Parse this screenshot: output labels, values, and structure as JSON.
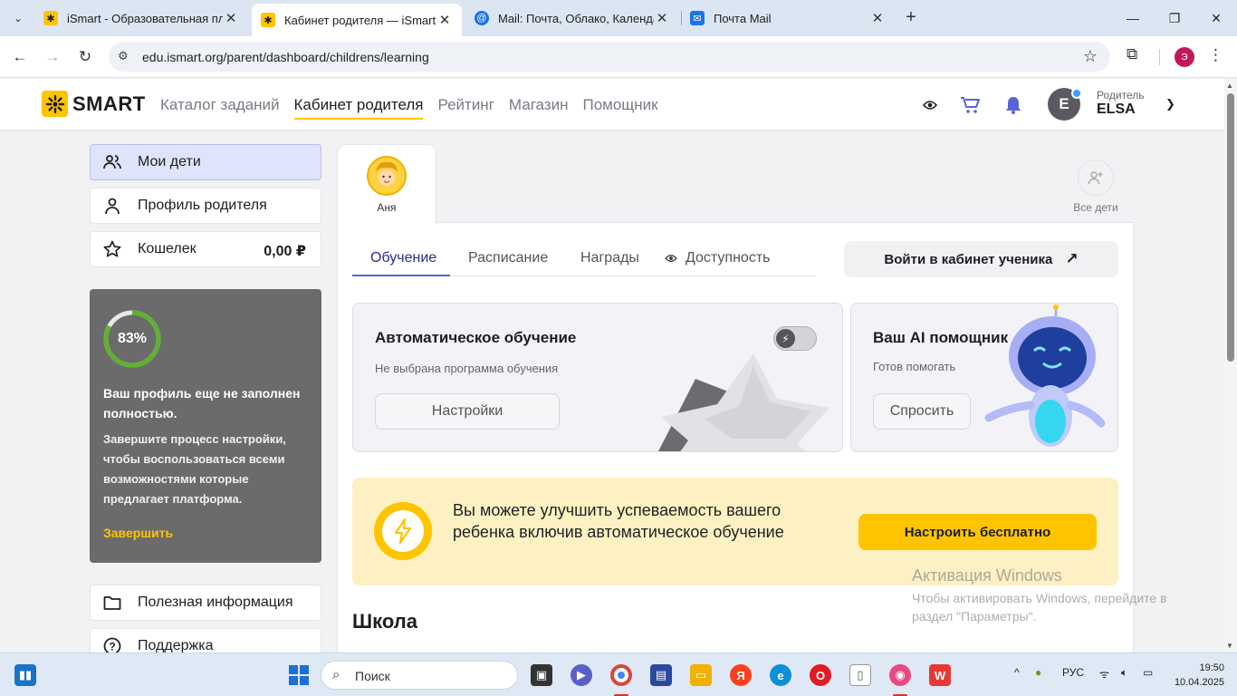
{
  "browser": {
    "tabs": [
      {
        "title": "iSmart - Образовательная пла",
        "active": false
      },
      {
        "title": "Кабинет родителя — iSmart",
        "active": true
      },
      {
        "title": "Mail: Почта, Облако, Календар",
        "active": false
      },
      {
        "title": "Почта Mail",
        "active": false
      }
    ],
    "url": "edu.ismart.org/parent/dashboard/childrens/learning",
    "profile_initial": "Э"
  },
  "header": {
    "logo": "SMART",
    "nav": [
      "Каталог заданий",
      "Кабинет родителя",
      "Рейтинг",
      "Магазин",
      "Помощник"
    ],
    "active_nav": "Кабинет родителя",
    "user": {
      "initial": "E",
      "role": "Родитель",
      "name": "ELSA"
    }
  },
  "sidebar": {
    "items": [
      {
        "label": "Мои дети",
        "active": true
      },
      {
        "label": "Профиль родителя"
      },
      {
        "label": "Кошелек",
        "amount": "0,00 ₽"
      }
    ],
    "profile_card": {
      "percent_label": "83%",
      "percent": 83,
      "title": "Ваш профиль еще не заполнен полностью.",
      "description": "Завершите процесс настройки, чтобы воспользоваться всеми возможностями которые предлагает платформа.",
      "link": "Завершить"
    },
    "bottom_items": [
      {
        "label": "Полезная информация"
      },
      {
        "label": "Поддержка"
      }
    ]
  },
  "children": {
    "selected": {
      "name": "Аня"
    },
    "all_label": "Все дети"
  },
  "main": {
    "tabs": [
      "Обучение",
      "Расписание",
      "Награды",
      "Доступность"
    ],
    "active_tab": "Обучение",
    "enter_button": "Войти в кабинет ученика",
    "auto_learning": {
      "title": "Автоматическое обучение",
      "subtitle": "Не выбрана программа обучения",
      "button": "Настройки",
      "toggle_on": false
    },
    "ai_helper": {
      "title": "Ваш AI помощник",
      "subtitle": "Готов помогать",
      "button": "Спросить"
    },
    "promo": {
      "text": "Вы можете улучшить успеваемость вашего ребенка включив автоматическое обучение",
      "button": "Настроить бесплатно"
    },
    "section_title": "Школа"
  },
  "watermark": {
    "title": "Активация Windows",
    "text": "Чтобы активировать Windows, перейдите в раздел \"Параметры\"."
  },
  "taskbar": {
    "search": "Поиск",
    "lang": "РУС",
    "time": "19:50",
    "date": "10.04.2025"
  },
  "colors": {
    "accent": "#ffc400",
    "active_tab": "#5a63d8",
    "sidebar_active": "#dfe3fb",
    "profile_card": "#6b6b6b"
  }
}
